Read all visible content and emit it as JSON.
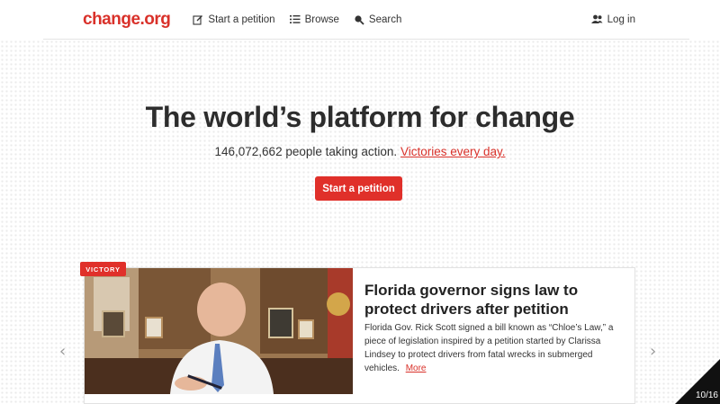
{
  "header": {
    "logo": "change.org",
    "nav": {
      "start_petition": "Start a petition",
      "browse": "Browse",
      "search": "Search"
    },
    "login": "Log in"
  },
  "hero": {
    "title": "The world’s platform for change",
    "count_text": "146,072,662 people taking action.",
    "victories_link": "Victories every day.",
    "cta": "Start a petition"
  },
  "featured": {
    "badge": "VICTORY",
    "title": "Florida governor signs law to protect drivers after petition",
    "body": "Florida Gov. Rick Scott signed a bill known as “Chloe’s Law,” a piece of legislation inspired by a petition started by Clarissa Lindsey to protect drivers from fatal wrecks in submerged vehicles.",
    "more": "More"
  },
  "carousel": {
    "prev_icon": "chevron-left-icon",
    "next_icon": "chevron-right-icon"
  },
  "slide_counter": "10/16",
  "colors": {
    "brand": "#d9312a",
    "button": "#e0302a"
  }
}
